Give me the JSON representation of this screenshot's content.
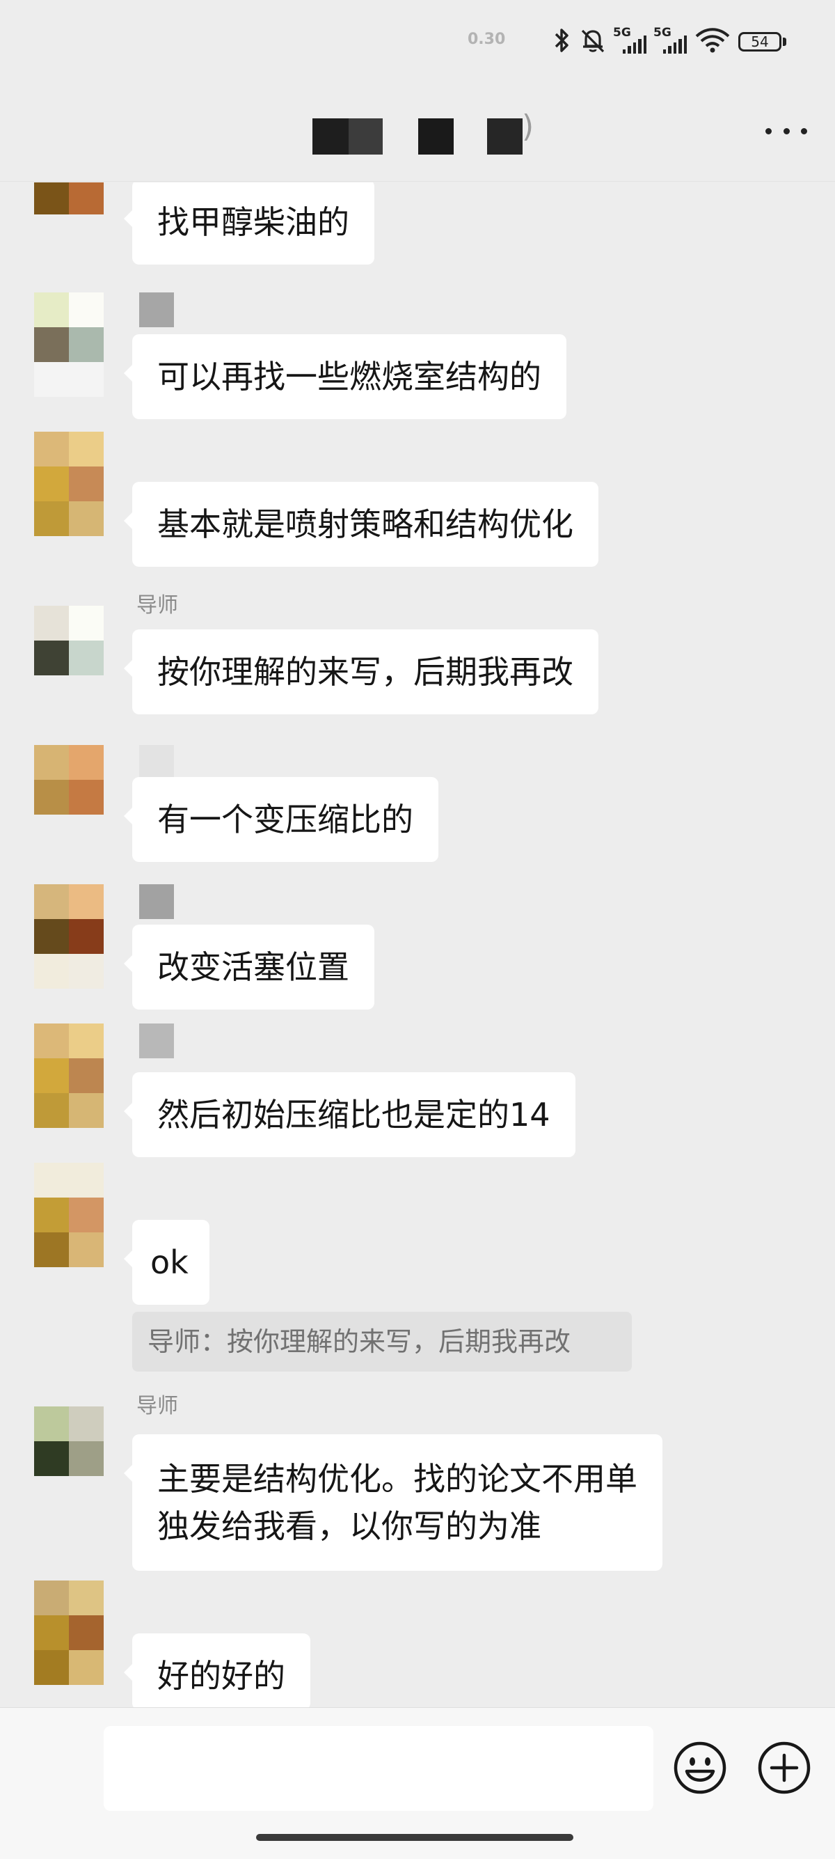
{
  "status_bar": {
    "net_speed": "0.30",
    "signal_1": "5G",
    "signal_2": "5G",
    "battery": "54",
    "icons": [
      "bluetooth-icon",
      "mute-bell-icon",
      "signal-icon",
      "wifi-icon",
      "battery-icon"
    ]
  },
  "header": {
    "more_icon": "ellipsis-icon"
  },
  "messages": [
    {
      "sender": "",
      "text": "找甲醇柴油的"
    },
    {
      "sender": "",
      "text": "可以再找一些燃烧室结构的"
    },
    {
      "sender": "",
      "text": "基本就是喷射策略和结构优化"
    },
    {
      "sender": "导师",
      "text": "按你理解的来写，后期我再改"
    },
    {
      "sender": "",
      "text": "有一个变压缩比的"
    },
    {
      "sender": "",
      "text": "改变活塞位置"
    },
    {
      "sender": "",
      "text": "然后初始压缩比也是定的14"
    },
    {
      "sender": "",
      "text": "ok"
    },
    {
      "sender": "导师",
      "line1": "主要是结构优化。找的论文不用单",
      "line2": "独发给我看，以你写的为准"
    },
    {
      "sender": "",
      "text": "好的好的"
    }
  ],
  "quote": {
    "text": "导师：按你理解的来写，后期我再改"
  },
  "input_bar": {
    "placeholder": "",
    "emoji_icon": "emoji-smile-icon",
    "plus_icon": "plus-circle-icon"
  }
}
